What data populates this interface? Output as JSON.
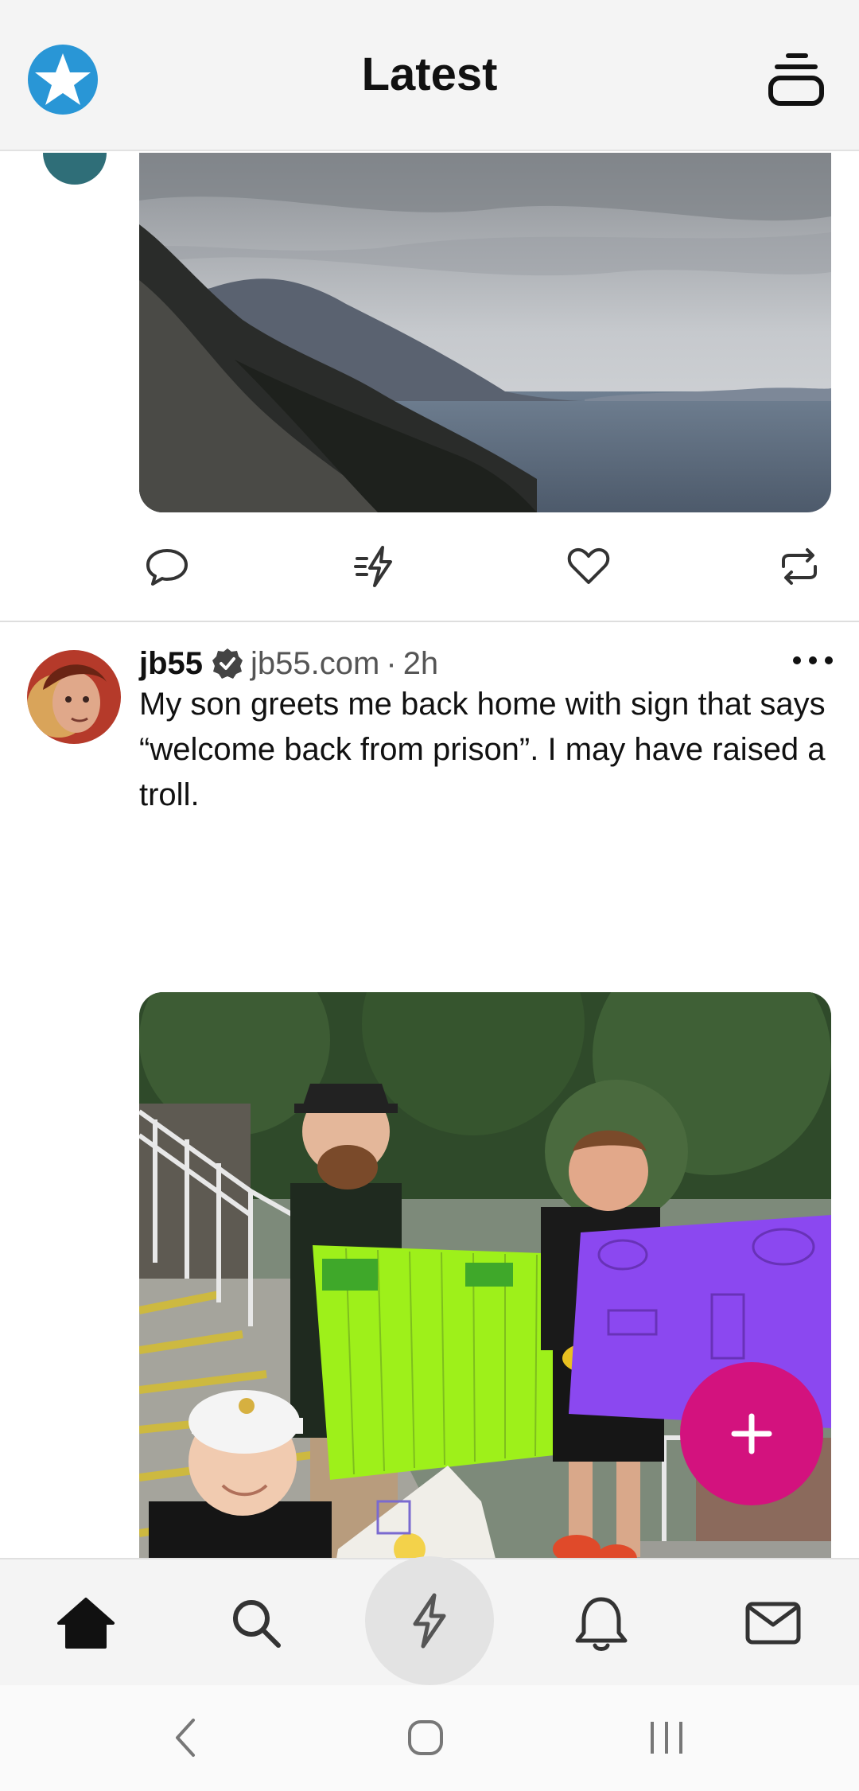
{
  "header": {
    "title": "Latest",
    "logo_icon": "star-logo-icon",
    "feeds_icon": "feeds-stack-icon"
  },
  "post1": {
    "image_alt": "Coastal mountain landscape",
    "actions": [
      "reply-icon",
      "boost-icon",
      "like-icon",
      "repost-icon"
    ]
  },
  "post2": {
    "author": "jb55",
    "handle": "jb55.com",
    "separator": "·",
    "time": "2h",
    "text": "My son greets me back home with sign that says “welcome back from prison”. I may have raised a troll.",
    "image_alt": "Family holding welcome back signs"
  },
  "fab": {
    "label": "+"
  },
  "bottom_nav": [
    "home-icon",
    "search-icon",
    "zap-icon",
    "bell-icon",
    "mail-icon"
  ],
  "system_nav": [
    "back-icon",
    "home-circle-icon",
    "recents-icon"
  ],
  "colors": {
    "accent": "#d3127e",
    "logo_blue": "#2996d6"
  }
}
